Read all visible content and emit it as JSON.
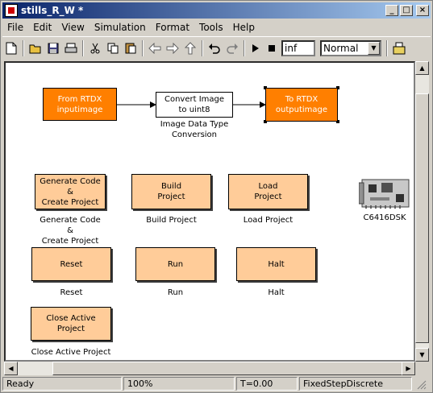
{
  "window": {
    "title": "stills_R_W *"
  },
  "titlebar_buttons": {
    "minimize": "_",
    "maximize": "□",
    "close": "×"
  },
  "menu": [
    "File",
    "Edit",
    "View",
    "Simulation",
    "Format",
    "Tools",
    "Help"
  ],
  "toolbar": {
    "icons": [
      "new-icon",
      "open-icon",
      "save-icon",
      "print-icon",
      "cut-icon",
      "copy-icon",
      "paste-icon",
      "back-icon",
      "forward-icon",
      "up-icon",
      "undo-icon",
      "redo-icon",
      "play-icon",
      "stop-icon",
      "library-browser-icon"
    ],
    "stop_time": "inf",
    "sim_mode": "Normal"
  },
  "blocks": {
    "from_rtdx": "From RTDX\ninputimage",
    "convert": "Convert Image\nto uint8",
    "convert_label": "Image Data Type\nConversion",
    "to_rtdx": "To RTDX\noutputimage",
    "gen_code": "Generate Code\n&\nCreate Project",
    "gen_code_label": "Generate Code\n&\nCreate Project",
    "build": "Build\nProject",
    "build_label": "Build Project",
    "load": "Load\nProject",
    "load_label": "Load Project",
    "dsk_label": "C6416DSK",
    "reset": "Reset",
    "reset_label": "Reset",
    "run": "Run",
    "run_label": "Run",
    "halt": "Halt",
    "halt_label": "Halt",
    "close": "Close Active Project",
    "close_label": "Close Active Project"
  },
  "status": {
    "state": "Ready",
    "zoom": "100%",
    "time": "T=0.00",
    "solver": "FixedStepDiscrete"
  },
  "colors": {
    "title_start": "#0a246a",
    "title_end": "#a6caf0",
    "rtdx_block": "#ff7f00",
    "button_block": "#ffcc99"
  }
}
